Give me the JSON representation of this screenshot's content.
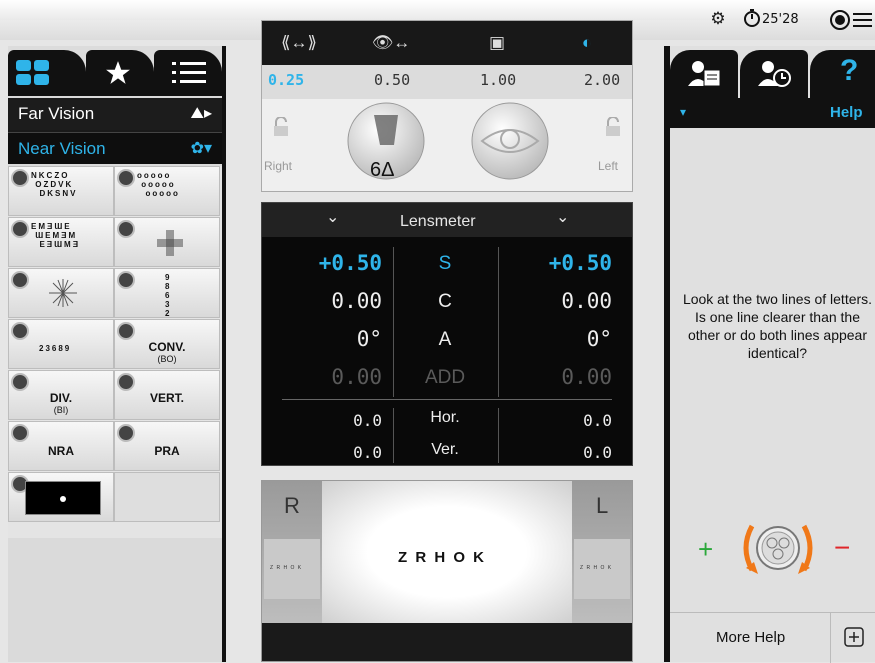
{
  "header": {
    "timer": "25'28"
  },
  "left_panel": {
    "vision_items": [
      {
        "label": "Far Vision"
      },
      {
        "label": "Near Vision"
      }
    ],
    "charts": [
      {
        "label": "",
        "sub": ""
      },
      {
        "label": "",
        "sub": ""
      },
      {
        "label": "",
        "sub": ""
      },
      {
        "label": "",
        "sub": ""
      },
      {
        "label": "",
        "sub": ""
      },
      {
        "label": "",
        "sub": ""
      },
      {
        "label": "",
        "sub": ""
      },
      {
        "label": "CONV.",
        "sub": "(BO)"
      },
      {
        "label": "DIV.",
        "sub": "(BI)"
      },
      {
        "label": "VERT.",
        "sub": ""
      },
      {
        "label": "NRA",
        "sub": ""
      },
      {
        "label": "PRA",
        "sub": ""
      }
    ]
  },
  "phoropter": {
    "steps": [
      "0.25",
      "0.50",
      "1.00",
      "2.00"
    ],
    "active_step": "0.25",
    "right_label": "Right",
    "left_label": "Left",
    "prism_value": "6Δ"
  },
  "lensmeter": {
    "title": "Lensmeter",
    "rows": [
      {
        "right": "+0.50",
        "label": "S",
        "left": "+0.50",
        "style": "blue"
      },
      {
        "right": "0.00",
        "label": "C",
        "left": "0.00",
        "style": "normal"
      },
      {
        "right": "0°",
        "label": "A",
        "left": "0°",
        "style": "normal"
      },
      {
        "right": "0.00",
        "label": "ADD",
        "left": "0.00",
        "style": "dim"
      }
    ],
    "prism_rows": [
      {
        "right": "0.0",
        "label": "Hor.",
        "left": "0.0"
      },
      {
        "right": "0.0",
        "label": "Ver.",
        "left": "0.0"
      }
    ]
  },
  "preview": {
    "right_label": "R",
    "left_label": "L",
    "main_letters": "Z R H O K",
    "small_letters": "Z R H O K"
  },
  "right_panel": {
    "help_title": "Help",
    "help_text": "Look at the two lines of letters. Is one line clearer than the other or do both lines appear identical?",
    "plus": "+",
    "minus": "−",
    "more_help": "More Help",
    "help_mark": "?"
  },
  "colors": {
    "accent": "#2fb4e9",
    "plus_green": "#2aa83a",
    "minus_red": "#e0262a",
    "arrow_orange": "#f07818"
  }
}
